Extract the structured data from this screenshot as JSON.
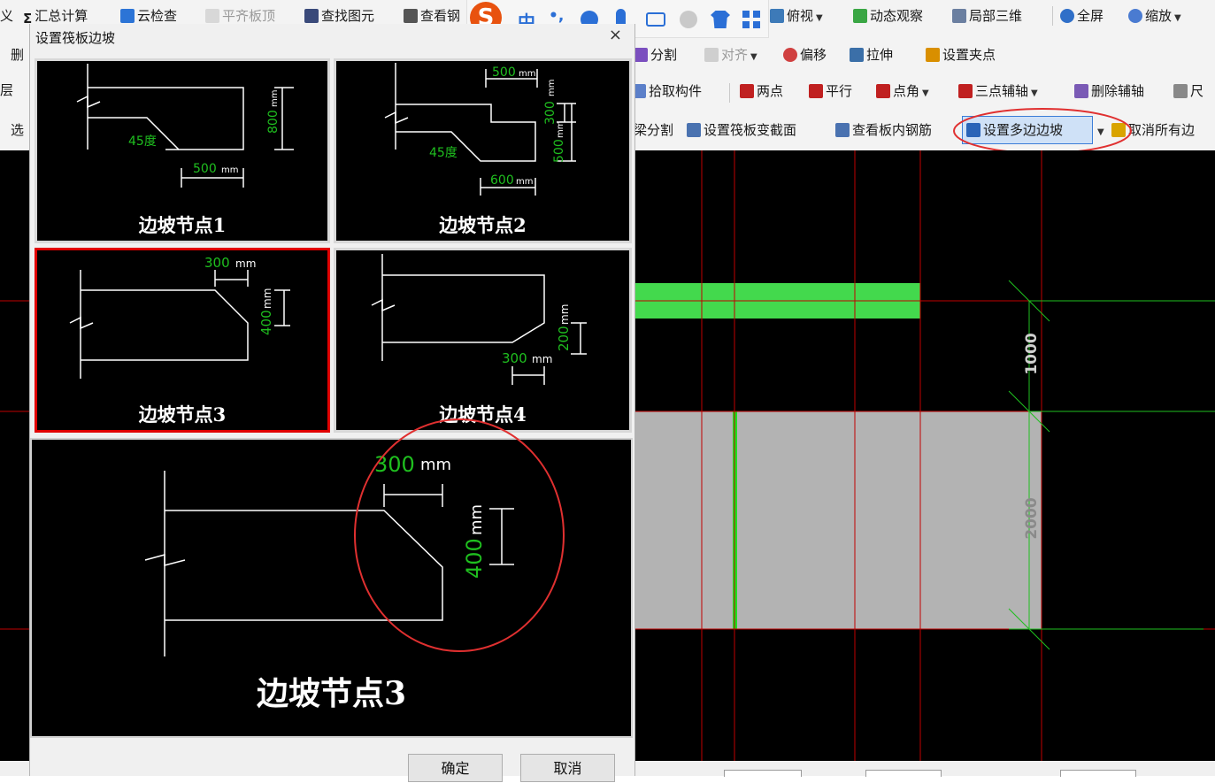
{
  "toolbar1": {
    "item_define": "义",
    "sum_calc": "汇总计算",
    "cloud_check": "云检查",
    "flush_top": "平齐板顶",
    "find_element": "查找图元",
    "view_steel": "查看钢",
    "top_view": "俯视",
    "dynamic_view": "动态观察",
    "local_3d": "局部三维",
    "fullscreen": "全屏",
    "zoom": "缩放"
  },
  "ime_bar": {
    "logo": "S",
    "mode": "中",
    "punct": "•,"
  },
  "toolbar2": {
    "delete": "删",
    "split": "分割",
    "align": "对齐",
    "offset": "偏移",
    "stretch": "拉伸",
    "grip": "设置夹点"
  },
  "toolbar3": {
    "layer": "层",
    "pick": "拾取构件",
    "two_points": "两点",
    "parallel": "平行",
    "point_angle": "点角",
    "three_point_axis": "三点辅轴",
    "delete_axis": "删除辅轴",
    "dimension": "尺"
  },
  "toolbar4": {
    "select": "选",
    "beam_split": "梁分割",
    "set_section": "设置筏板变截面",
    "view_rebar": "查看板内钢筋",
    "set_multi_slope": "设置多边边坡",
    "cancel_all": "取消所有边"
  },
  "canvas": {
    "dim_1000": "1000",
    "dim_2000": "2000"
  },
  "colors": {
    "canvas_bg": "#000000",
    "grid_line": "#c00000",
    "green_beam": "#43d94d",
    "slab_gray": "#b3b3b3",
    "dim_green": "#1fbf1f",
    "highlight_border": "#3b7dd8",
    "annotation_red": "#e03030"
  },
  "dialog": {
    "title": "设置筏板边坡",
    "close": "×",
    "nodes": [
      {
        "label": "边坡节点1",
        "dims": [
          "45度",
          "500",
          "mm",
          "800",
          "mm"
        ]
      },
      {
        "label": "边坡节点2",
        "dims": [
          "500",
          "mm",
          "45度",
          "300",
          "mm",
          "500",
          "mm",
          "600",
          "mm"
        ]
      },
      {
        "label": "边坡节点3",
        "dims": [
          "300",
          "mm",
          "400",
          "mm"
        ]
      },
      {
        "label": "边坡节点4",
        "dims": [
          "200",
          "mm",
          "300",
          "mm"
        ]
      }
    ],
    "selected_index": 2,
    "preview": {
      "label": "边坡节点3",
      "dim_h_value": "300",
      "dim_h_unit": "mm",
      "dim_v_value": "400",
      "dim_v_unit": "mm"
    },
    "ok": "确定",
    "cancel": "取消"
  }
}
